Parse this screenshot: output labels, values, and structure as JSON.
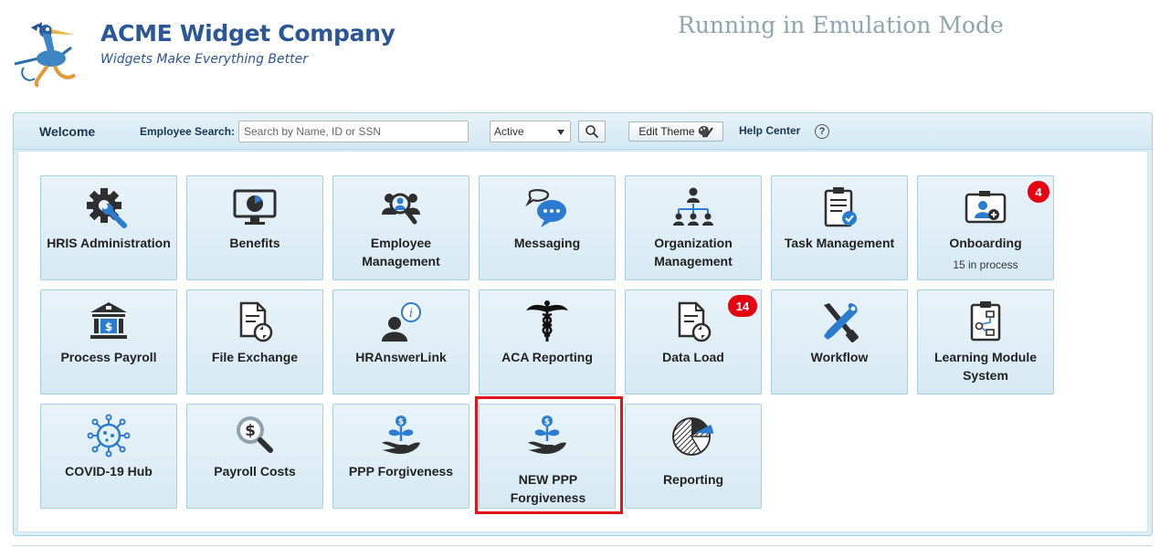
{
  "header": {
    "company_name": "ACME Widget Company",
    "tagline": "Widgets Make Everything Better",
    "emulation_notice": "Running in Emulation Mode"
  },
  "toolbar": {
    "welcome": "Welcome",
    "search_label": "Employee Search:",
    "search_placeholder": "Search by Name, ID or SSN",
    "status_value": "Active",
    "edit_theme": "Edit Theme",
    "help_center": "Help Center",
    "help_glyph": "?"
  },
  "colors": {
    "accent": "#2b5797",
    "tile_border": "#a6cfe0",
    "badge": "#e60012",
    "highlight": "#e2141b"
  },
  "tiles": [
    {
      "label": "HRIS Administration",
      "icon": "gear-wrench-icon"
    },
    {
      "label": "Benefits",
      "icon": "monitor-pie-icon"
    },
    {
      "label": "Employee Management",
      "icon": "people-search-icon"
    },
    {
      "label": "Messaging",
      "icon": "chat-bubbles-icon"
    },
    {
      "label": "Organization Management",
      "icon": "org-chart-icon"
    },
    {
      "label": "Task Management",
      "icon": "clipboard-check-icon"
    },
    {
      "label": "Onboarding",
      "icon": "id-card-add-icon",
      "sub": "15 in process",
      "badge": "4"
    },
    {
      "label": "Process Payroll",
      "icon": "bank-icon"
    },
    {
      "label": "File Exchange",
      "icon": "file-sync-icon"
    },
    {
      "label": "HRAnswerLink",
      "icon": "person-info-icon"
    },
    {
      "label": "ACA Reporting",
      "icon": "caduceus-icon"
    },
    {
      "label": "Data Load",
      "icon": "file-sync-icon",
      "badge": "14"
    },
    {
      "label": "Workflow",
      "icon": "tools-icon"
    },
    {
      "label": "Learning Module System",
      "icon": "clipboard-flow-icon"
    },
    {
      "label": "COVID-19 Hub",
      "icon": "virus-icon"
    },
    {
      "label": "Payroll Costs",
      "icon": "dollar-magnifier-icon"
    },
    {
      "label": "PPP Forgiveness",
      "icon": "money-plant-hand-icon"
    },
    {
      "label": "NEW PPP Forgiveness",
      "icon": "money-plant-hand-icon"
    },
    {
      "label": "Reporting",
      "icon": "pie-chart-icon"
    }
  ]
}
